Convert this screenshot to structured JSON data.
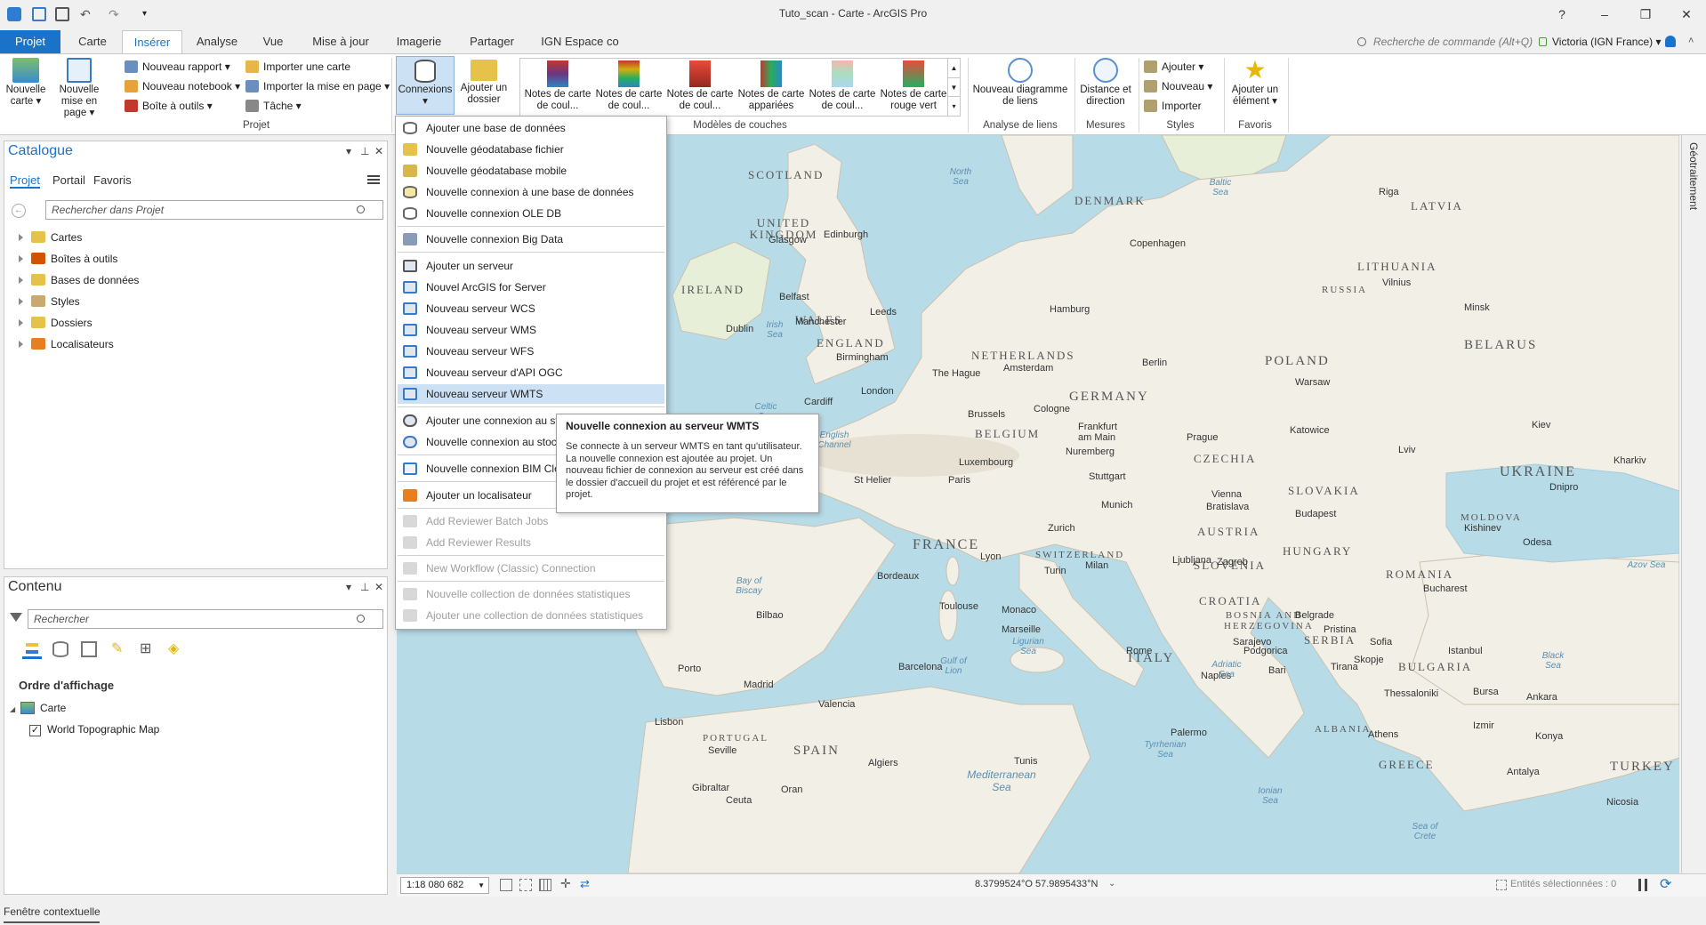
{
  "window": {
    "title": "Tuto_scan - Carte - ArcGIS Pro",
    "help": "?",
    "minimize": "–",
    "restore": "❐",
    "close": "✕"
  },
  "tabs": [
    {
      "label": "Projet"
    },
    {
      "label": "Carte"
    },
    {
      "label": "Insérer"
    },
    {
      "label": "Analyse"
    },
    {
      "label": "Vue"
    },
    {
      "label": "Mise à jour"
    },
    {
      "label": "Imagerie"
    },
    {
      "label": "Partager"
    },
    {
      "label": "IGN Espace co"
    }
  ],
  "command_search": {
    "placeholder": "Recherche de commande (Alt+Q)"
  },
  "user": {
    "label": "Victoria (IGN France) ▾"
  },
  "ribbon": {
    "projet": {
      "new_map": "Nouvelle carte ▾",
      "new_layout": "Nouvelle mise en page ▾",
      "new_report": "Nouveau rapport ▾",
      "new_notebook": "Nouveau notebook ▾",
      "toolbox": "Boîte à outils ▾",
      "import_map": "Importer une carte",
      "import_layout": "Importer la mise en page ▾",
      "task": "Tâche ▾",
      "group_label": "Projet"
    },
    "connections": {
      "label": "Connexions ▾",
      "add_folder": "Ajouter un dossier"
    },
    "layer_templates": {
      "items": [
        {
          "label": "Notes de carte de coul..."
        },
        {
          "label": "Notes de carte de coul..."
        },
        {
          "label": "Notes de carte de coul..."
        },
        {
          "label": "Notes de carte appariées"
        },
        {
          "label": "Notes de carte de coul..."
        },
        {
          "label": "Notes de carte rouge vert"
        }
      ],
      "group_label": "Modèles de couches"
    },
    "link_analysis": {
      "label": "Nouveau diagramme de liens",
      "group_label": "Analyse de liens"
    },
    "measures": {
      "label": "Distance et direction",
      "group_label": "Mesures"
    },
    "styles": {
      "add": "Ajouter ▾",
      "new": "Nouveau ▾",
      "import": "Importer",
      "group_label": "Styles"
    },
    "favorites": {
      "label": "Ajouter un élément ▾",
      "group_label": "Favoris"
    }
  },
  "catalog": {
    "title": "Catalogue",
    "subtabs": [
      "Projet",
      "Portail",
      "Favoris"
    ],
    "search_placeholder": "Rechercher dans Projet",
    "items": [
      {
        "label": "Cartes"
      },
      {
        "label": "Boîtes à outils"
      },
      {
        "label": "Bases de données"
      },
      {
        "label": "Styles"
      },
      {
        "label": "Dossiers"
      },
      {
        "label": "Localisateurs"
      }
    ]
  },
  "contents": {
    "title": "Contenu",
    "search_placeholder": "Rechercher",
    "draw_order": "Ordre d'affichage",
    "map_name": "Carte",
    "layer": "World Topographic Map"
  },
  "menu": {
    "items": [
      {
        "label": "Ajouter une base de données",
        "disabled": false
      },
      {
        "label": "Nouvelle géodatabase fichier",
        "disabled": false
      },
      {
        "label": "Nouvelle géodatabase mobile",
        "disabled": false
      },
      {
        "label": "Nouvelle connexion à une base de données",
        "disabled": false
      },
      {
        "label": "Nouvelle connexion OLE DB",
        "disabled": false
      },
      {
        "label": "Nouvelle connexion Big Data",
        "disabled": false
      },
      {
        "label": "Ajouter un serveur",
        "disabled": false
      },
      {
        "label": "Nouvel ArcGIS for Server",
        "disabled": false
      },
      {
        "label": "Nouveau serveur WCS",
        "disabled": false
      },
      {
        "label": "Nouveau serveur WMS",
        "disabled": false
      },
      {
        "label": "Nouveau serveur WFS",
        "disabled": false
      },
      {
        "label": "Nouveau serveur d'API OGC",
        "disabled": false
      },
      {
        "label": "Nouveau serveur WMTS",
        "disabled": false
      },
      {
        "label": "Ajouter une connexion au stockage",
        "disabled": false
      },
      {
        "label": "Nouvelle connexion au stockage",
        "disabled": false
      },
      {
        "label": "Nouvelle connexion BIM Cloud",
        "disabled": false
      },
      {
        "label": "Ajouter un localisateur",
        "disabled": false
      },
      {
        "label": "Add Reviewer Batch Jobs",
        "disabled": true
      },
      {
        "label": "Add Reviewer Results",
        "disabled": true
      },
      {
        "label": "New Workflow (Classic) Connection",
        "disabled": true
      },
      {
        "label": "Nouvelle collection de données statistiques",
        "disabled": true
      },
      {
        "label": "Ajouter une collection de données statistiques",
        "disabled": true
      }
    ]
  },
  "tooltip": {
    "title": "Nouvelle connexion au serveur WMTS",
    "body": "Se connecte à un serveur WMTS en tant qu'utilisateur. La nouvelle connexion est ajoutée au projet. Un nouveau fichier de connexion au serveur est créé dans le dossier d'accueil du projet et est référencé par le projet."
  },
  "map_labels": {
    "countries": [
      "SCOTLAND",
      "UNITED KINGDOM",
      "IRELAND",
      "WALES",
      "ENGLAND",
      "DENMARK",
      "NETHERLANDS",
      "BELGIUM",
      "GERMANY",
      "POLAND",
      "LATVIA",
      "LITHUANIA",
      "RUSSIA",
      "BELARUS",
      "UKRAINE",
      "CZECHIA",
      "SLOVAKIA",
      "AUSTRIA",
      "HUNGARY",
      "MOLDOVA",
      "ROMANIA",
      "FRANCE",
      "SWITZERLAND",
      "SLOVENIA",
      "CROATIA",
      "BOSNIA AND HERZEGOVINA",
      "SERBIA",
      "BULGARIA",
      "ITALY",
      "PORTUGAL",
      "SPAIN",
      "ALBANIA",
      "GREECE",
      "TURKEY"
    ],
    "cities": [
      "Riga",
      "Glasgow",
      "Edinburgh",
      "Copenhagen",
      "Belfast",
      "Manchester",
      "Leeds",
      "Dublin",
      "Hamburg",
      "Vilnius",
      "Minsk",
      "Birmingham",
      "Amsterdam",
      "The Hague",
      "Berlin",
      "Warsaw",
      "London",
      "Cardiff",
      "Cologne",
      "Brussels",
      "Frankfurt am Main",
      "Prague",
      "Katowice",
      "Kiev",
      "Luxembourg",
      "Nuremberg",
      "Lviv",
      "Paris",
      "Stuttgart",
      "St Helier",
      "Munich",
      "Vienna",
      "Bratislava",
      "Budapest",
      "Dnipro",
      "Kharkiv",
      "Kishinev",
      "Zurich",
      "Lyon",
      "Ljubljana",
      "Zagreb",
      "Odesa",
      "Turin",
      "Milan",
      "Bordeaux",
      "Belgrade",
      "Bucharest",
      "Sarajevo",
      "Toulouse",
      "Monaco",
      "Marseille",
      "Bilbao",
      "Pristina",
      "Sofia",
      "Rome",
      "Podgorica",
      "Skopje",
      "Porto",
      "Barcelona",
      "Bari",
      "Naples",
      "Tirana",
      "Istanbul",
      "Bursa",
      "Madrid",
      "Valencia",
      "Thessaloniki",
      "Ankara",
      "Lisbon",
      "Palermo",
      "Athens",
      "Izmir",
      "Konya",
      "Seville",
      "Algiers",
      "Tunis",
      "Antalya",
      "Gibraltar",
      "Ceuta",
      "Oran",
      "Nicosia"
    ],
    "seas": [
      "North Sea",
      "Baltic Sea",
      "Irish Sea",
      "Celtic Sea",
      "English Channel",
      "Bay of Biscay",
      "Ligurian Sea",
      "Gulf of Lion",
      "Adriatic Sea",
      "Tyrrhenian Sea",
      "Black Sea",
      "Azov Sea",
      "Mediterranean Sea",
      "Ionian Sea",
      "Sea of Crete"
    ]
  },
  "map_status": {
    "scale": "1:18 080 682",
    "coords": "8.3799524°O 57.9895433°N",
    "selected": "Entités sélectionnées : 0"
  },
  "side_panel": {
    "label": "Géotraitement"
  },
  "bottom": {
    "label": "Fenêtre contextuelle"
  },
  "colors": {
    "accent": "#1a73c8",
    "highlight": "#cde1f5",
    "map_water": "#b8dbe8",
    "map_land": "#f2efe6"
  }
}
